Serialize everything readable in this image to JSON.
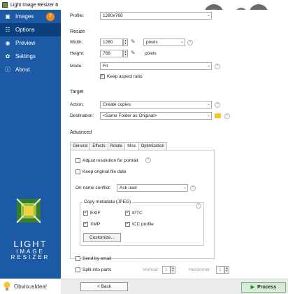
{
  "window": {
    "title": "Light Image Resizer 6"
  },
  "overlay": {
    "lens": "lens-icon",
    "close": "✕",
    "more": "⋮"
  },
  "sidebar": {
    "items": [
      {
        "label": "Images",
        "icon": "images-icon",
        "badge": "7"
      },
      {
        "label": "Options",
        "icon": "options-icon"
      },
      {
        "label": "Preview",
        "icon": "preview-icon"
      },
      {
        "label": "Settings",
        "icon": "settings-icon"
      },
      {
        "label": "About",
        "icon": "about-icon"
      }
    ],
    "brand": {
      "line1": "LIGHT",
      "line2": "IMAGE",
      "line3": "RESIZER"
    },
    "company": "ObviousIdea!"
  },
  "profile": {
    "label": "Profile:",
    "value": "1280x768"
  },
  "resize": {
    "heading": "Resize",
    "width_label": "Width:",
    "width_value": "1280",
    "height_label": "Height:",
    "height_value": "768",
    "unit_value": "pixels",
    "unit_text": "pixels",
    "mode_label": "Mode:",
    "mode_value": "Fit",
    "keep_aspect": "Keep aspect ratio"
  },
  "target": {
    "heading": "Target",
    "action_label": "Action:",
    "action_value": "Create copies",
    "destination_label": "Destination:",
    "destination_value": "<Same Folder as Original>"
  },
  "advanced": {
    "heading": "Advanced",
    "tabs": [
      "General",
      "Effects",
      "Rotate",
      "Misc",
      "Optimization"
    ],
    "adjust_portrait": "Adjust resolution for portrait",
    "keep_date": "Keep original file date",
    "conflict_label": "On name conflict:",
    "conflict_value": "Ask user",
    "metadata_heading": "Copy metadata (JPEG)",
    "exif": "EXIF",
    "iptc": "IPTC",
    "xmp": "XMP",
    "icc": "ICC profile",
    "customize": "Customize...",
    "send_email": "Send by email",
    "split_parts": "Split into parts",
    "vertical_label": "Vertical:",
    "vertical_value": "1",
    "horizontal_label": "Horizontal:",
    "horizontal_value": "1"
  },
  "footer": {
    "back": "< Back",
    "process": "Process"
  },
  "colors": {
    "sidebar": "#1c5aa6",
    "active": "#0c3f7d",
    "badge": "#f08a1d",
    "process": "#d7ecd8"
  }
}
